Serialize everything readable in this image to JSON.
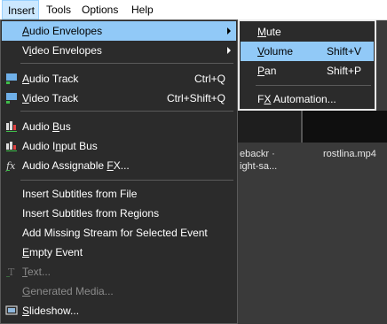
{
  "menubar": {
    "items": [
      {
        "label": "Insert"
      },
      {
        "label": "Tools"
      },
      {
        "label": "Options"
      },
      {
        "label": "Help"
      }
    ]
  },
  "background": {
    "clip_left_top": "ebackr ·",
    "clip_left_bottom": "ight-sa...",
    "clip_right": "rostlina.mp4"
  },
  "insert_menu": {
    "items": [
      {
        "pre": "",
        "u": "A",
        "post": "udio Envelopes",
        "shortcut": ""
      },
      {
        "pre": "V",
        "u": "i",
        "post": "deo Envelopes",
        "shortcut": ""
      },
      {
        "pre": "",
        "u": "A",
        "post": "udio Track",
        "shortcut": "Ctrl+Q"
      },
      {
        "pre": "",
        "u": "V",
        "post": "ideo Track",
        "shortcut": "Ctrl+Shift+Q"
      },
      {
        "pre": "Audio ",
        "u": "B",
        "post": "us",
        "shortcut": ""
      },
      {
        "pre": "Audio I",
        "u": "n",
        "post": "put Bus",
        "shortcut": ""
      },
      {
        "pre": "Audio Assignable ",
        "u": "F",
        "post": "X...",
        "shortcut": ""
      },
      {
        "pre": "Insert Subtitles from File",
        "u": "",
        "post": "",
        "shortcut": ""
      },
      {
        "pre": "Insert Subtitles from Regions",
        "u": "",
        "post": "",
        "shortcut": ""
      },
      {
        "pre": "Add Missing Stream for Selected Event",
        "u": "",
        "post": "",
        "shortcut": ""
      },
      {
        "pre": "",
        "u": "E",
        "post": "mpty Event",
        "shortcut": ""
      },
      {
        "pre": "",
        "u": "T",
        "post": "ext...",
        "shortcut": ""
      },
      {
        "pre": "",
        "u": "G",
        "post": "enerated Media...",
        "shortcut": ""
      },
      {
        "pre": "",
        "u": "S",
        "post": "lideshow...",
        "shortcut": ""
      }
    ]
  },
  "audio_envelopes_submenu": {
    "items": [
      {
        "pre": "",
        "u": "M",
        "post": "ute",
        "shortcut": ""
      },
      {
        "pre": "",
        "u": "V",
        "post": "olume",
        "shortcut": "Shift+V"
      },
      {
        "pre": "",
        "u": "P",
        "post": "an",
        "shortcut": "Shift+P"
      },
      {
        "pre": "F",
        "u": "X",
        "post": " Automation...",
        "shortcut": ""
      }
    ]
  },
  "colors": {
    "highlight": "#91c9f7",
    "menu_bg": "#2b2b2b",
    "disabled_text": "#8a8a8a"
  }
}
